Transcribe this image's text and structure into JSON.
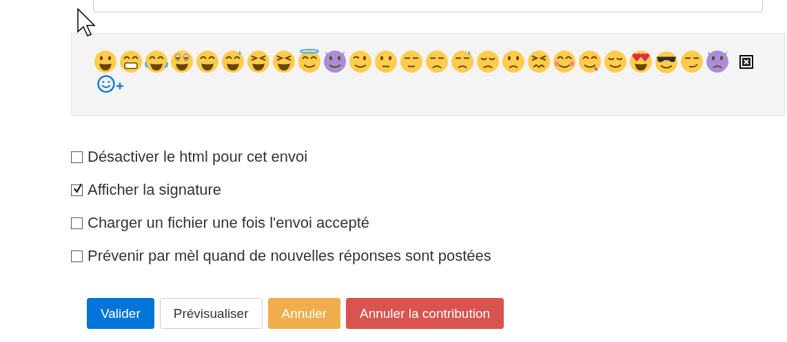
{
  "options": [
    {
      "label": "Désactiver le html pour cet envoi",
      "checked": false
    },
    {
      "label": "Afficher la signature",
      "checked": true
    },
    {
      "label": "Charger un fichier une fois l'envoi accepté",
      "checked": false
    },
    {
      "label": "Prévenir par mèl quand de nouvelles réponses sont postées",
      "checked": false
    }
  ],
  "buttons": [
    {
      "label": "Valider",
      "kind": "primary"
    },
    {
      "label": "Prévisualiser",
      "kind": "default"
    },
    {
      "label": "Annuler",
      "kind": "warning"
    },
    {
      "label": "Annuler la contribution",
      "kind": "danger"
    }
  ]
}
